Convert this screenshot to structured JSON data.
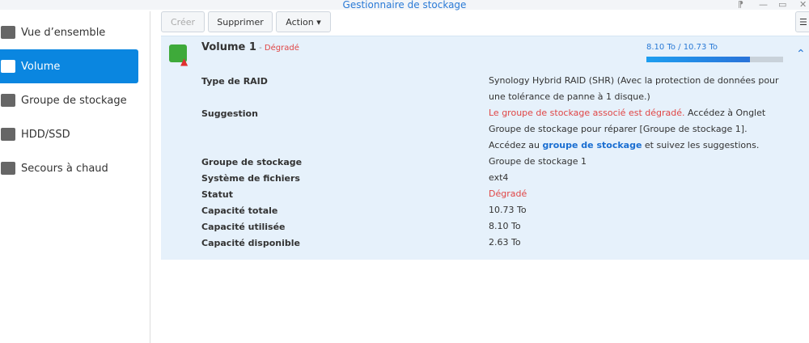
{
  "window": {
    "title": "Gestionnaire de stockage"
  },
  "sidebar": {
    "items": [
      {
        "label": "Vue d’ensemble"
      },
      {
        "label": "Volume"
      },
      {
        "label": "Groupe de stockage"
      },
      {
        "label": "HDD/SSD"
      },
      {
        "label": "Secours à chaud"
      }
    ]
  },
  "toolbar": {
    "create": "Créer",
    "delete": "Supprimer",
    "action": "Action ▾"
  },
  "volume": {
    "name": "Volume 1",
    "sep": " - ",
    "status": "Dégradé",
    "usage_text": "8.10 To / 10.73 To",
    "usage_fraction": 0.755,
    "fields": [
      {
        "label": "Type de RAID",
        "value": "Synology Hybrid RAID (SHR) (Avec la protection de données pour une tolérance de panne à 1 disque.)"
      },
      {
        "label": "Suggestion",
        "value_red": "Le groupe de stockage associé est dégradé.",
        "value": " Accédez à Onglet Groupe de stockage pour réparer [Groupe de stockage 1].",
        "value2": "Accédez au ",
        "link": "groupe de stockage",
        "value3": " et suivez les suggestions."
      },
      {
        "label": "Groupe de stockage",
        "value": "Groupe de stockage 1"
      },
      {
        "label": "Système de fichiers",
        "value": "ext4"
      },
      {
        "label": "Statut",
        "value": "Dégradé"
      },
      {
        "label": "Capacité totale",
        "value": "10.73 To"
      },
      {
        "label": "Capacité utilisée",
        "value": "8.10 To"
      },
      {
        "label": "Capacité disponible",
        "value": "2.63 To"
      }
    ]
  }
}
